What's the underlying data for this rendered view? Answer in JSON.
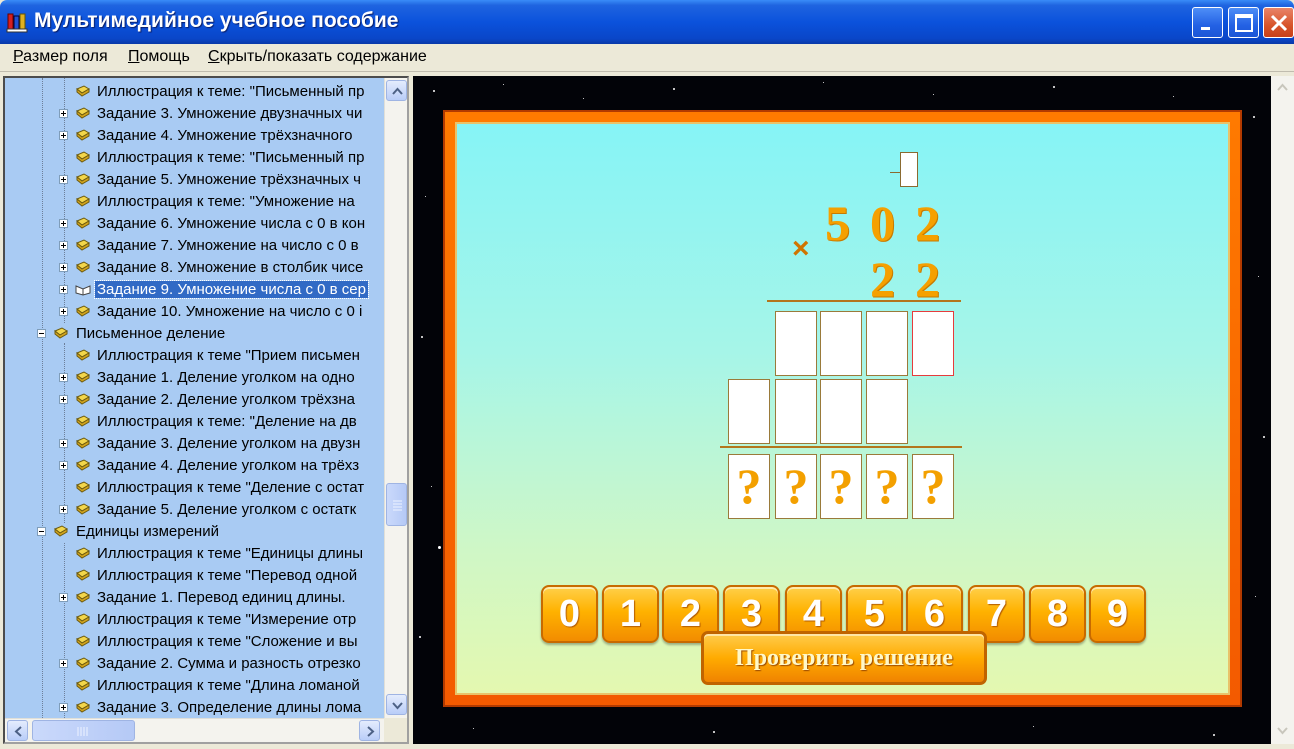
{
  "window": {
    "title": "Мультимедийное учебное пособие",
    "icon": "app-books-icon",
    "controls": [
      "minimize-icon",
      "maximize-icon",
      "close-icon"
    ]
  },
  "menu": {
    "items": [
      {
        "label": "Размер поля",
        "u": "Р",
        "rest": "азмер поля"
      },
      {
        "label": "Помощь",
        "u": "П",
        "rest": "омощь"
      },
      {
        "label": "Скрыть/показать содержание",
        "u": "С",
        "rest": "крыть/показать содержание"
      }
    ]
  },
  "tree": {
    "items": [
      {
        "level": 2,
        "expand": "",
        "icon": "book-icon",
        "label": "Иллюстрация к теме: \"Письменный пр",
        "selected": false
      },
      {
        "level": 2,
        "expand": "plus",
        "icon": "book-icon",
        "label": "Задание 3. Умножение двузначных чи",
        "selected": false
      },
      {
        "level": 2,
        "expand": "plus",
        "icon": "book-icon",
        "label": "Задание 4. Умножение трёхзначного",
        "selected": false
      },
      {
        "level": 2,
        "expand": "",
        "icon": "book-icon",
        "label": "Иллюстрация к теме: \"Письменный пр",
        "selected": false
      },
      {
        "level": 2,
        "expand": "plus",
        "icon": "book-icon",
        "label": "Задание 5. Умножение трёхзначных ч",
        "selected": false
      },
      {
        "level": 2,
        "expand": "",
        "icon": "book-icon",
        "label": "Иллюстрация к теме: \"Умножение на",
        "selected": false
      },
      {
        "level": 2,
        "expand": "plus",
        "icon": "book-icon",
        "label": "Задание 6. Умножение числа с 0 в кон",
        "selected": false
      },
      {
        "level": 2,
        "expand": "plus",
        "icon": "book-icon",
        "label": "Задание 7. Умножение на число с 0 в",
        "selected": false
      },
      {
        "level": 2,
        "expand": "plus",
        "icon": "book-icon",
        "label": "Задание 8. Умножение в столбик чисе",
        "selected": false
      },
      {
        "level": 2,
        "expand": "plus",
        "icon": "open-book-icon",
        "label": "Задание 9. Умножение числа с 0 в сер",
        "selected": true
      },
      {
        "level": 2,
        "expand": "plus",
        "icon": "book-icon",
        "label": "Задание 10. Умножение на число с 0 i",
        "selected": false
      },
      {
        "level": 1,
        "expand": "minus",
        "icon": "book-icon",
        "label": "Письменное деление",
        "selected": false
      },
      {
        "level": 2,
        "expand": "",
        "icon": "book-icon",
        "label": "Иллюстрация к теме \"Прием письмен",
        "selected": false
      },
      {
        "level": 2,
        "expand": "plus",
        "icon": "book-icon",
        "label": "Задание 1. Деление уголком на одно",
        "selected": false
      },
      {
        "level": 2,
        "expand": "plus",
        "icon": "book-icon",
        "label": "Задание 2. Деление уголком трёхзна",
        "selected": false
      },
      {
        "level": 2,
        "expand": "",
        "icon": "book-icon",
        "label": "Иллюстрация к теме: \"Деление на дв",
        "selected": false
      },
      {
        "level": 2,
        "expand": "plus",
        "icon": "book-icon",
        "label": "Задание 3. Деление уголком на двузн",
        "selected": false
      },
      {
        "level": 2,
        "expand": "plus",
        "icon": "book-icon",
        "label": "Задание 4. Деление уголком на трёхз",
        "selected": false
      },
      {
        "level": 2,
        "expand": "",
        "icon": "book-icon",
        "label": "Иллюстрация к теме \"Деление с остат",
        "selected": false
      },
      {
        "level": 2,
        "expand": "plus",
        "icon": "book-icon",
        "label": "Задание 5. Деление уголком с остатк",
        "selected": false
      },
      {
        "level": 1,
        "expand": "minus",
        "icon": "book-icon",
        "label": "Единицы измерений",
        "selected": false
      },
      {
        "level": 2,
        "expand": "",
        "icon": "book-icon",
        "label": "Иллюстрация к теме \"Единицы длины",
        "selected": false
      },
      {
        "level": 2,
        "expand": "",
        "icon": "book-icon",
        "label": "Иллюстрация к теме \"Перевод одной",
        "selected": false
      },
      {
        "level": 2,
        "expand": "plus",
        "icon": "book-icon",
        "label": "Задание 1. Перевод единиц длины.",
        "selected": false
      },
      {
        "level": 2,
        "expand": "",
        "icon": "book-icon",
        "label": "Иллюстрация к теме \"Измерение отр",
        "selected": false
      },
      {
        "level": 2,
        "expand": "",
        "icon": "book-icon",
        "label": "Иллюстрация к теме \"Сложение и вы",
        "selected": false
      },
      {
        "level": 2,
        "expand": "plus",
        "icon": "book-icon",
        "label": "Задание 2. Сумма и разность отрезко",
        "selected": false
      },
      {
        "level": 2,
        "expand": "",
        "icon": "book-icon",
        "label": "Иллюстрация к теме \"Длина ломаной",
        "selected": false
      },
      {
        "level": 2,
        "expand": "plus",
        "icon": "book-icon",
        "label": "Задание 3. Определение длины лома",
        "selected": false
      }
    ]
  },
  "exercise": {
    "operator": "×",
    "multiplicand": [
      "5",
      "0",
      "2"
    ],
    "multiplier": [
      "2",
      "2"
    ],
    "partial1_cells": 4,
    "partial2_cells": 4,
    "result_cells": [
      "?",
      "?",
      "?",
      "?",
      "?"
    ],
    "keypad": [
      "0",
      "1",
      "2",
      "3",
      "4",
      "5",
      "6",
      "7",
      "8",
      "9"
    ],
    "check_label": "Проверить решение"
  },
  "colors": {
    "selection": "#316ac5",
    "tree_bg": "#a9cbf3",
    "digit": "#f5a000",
    "frame": "#ff7a00"
  }
}
